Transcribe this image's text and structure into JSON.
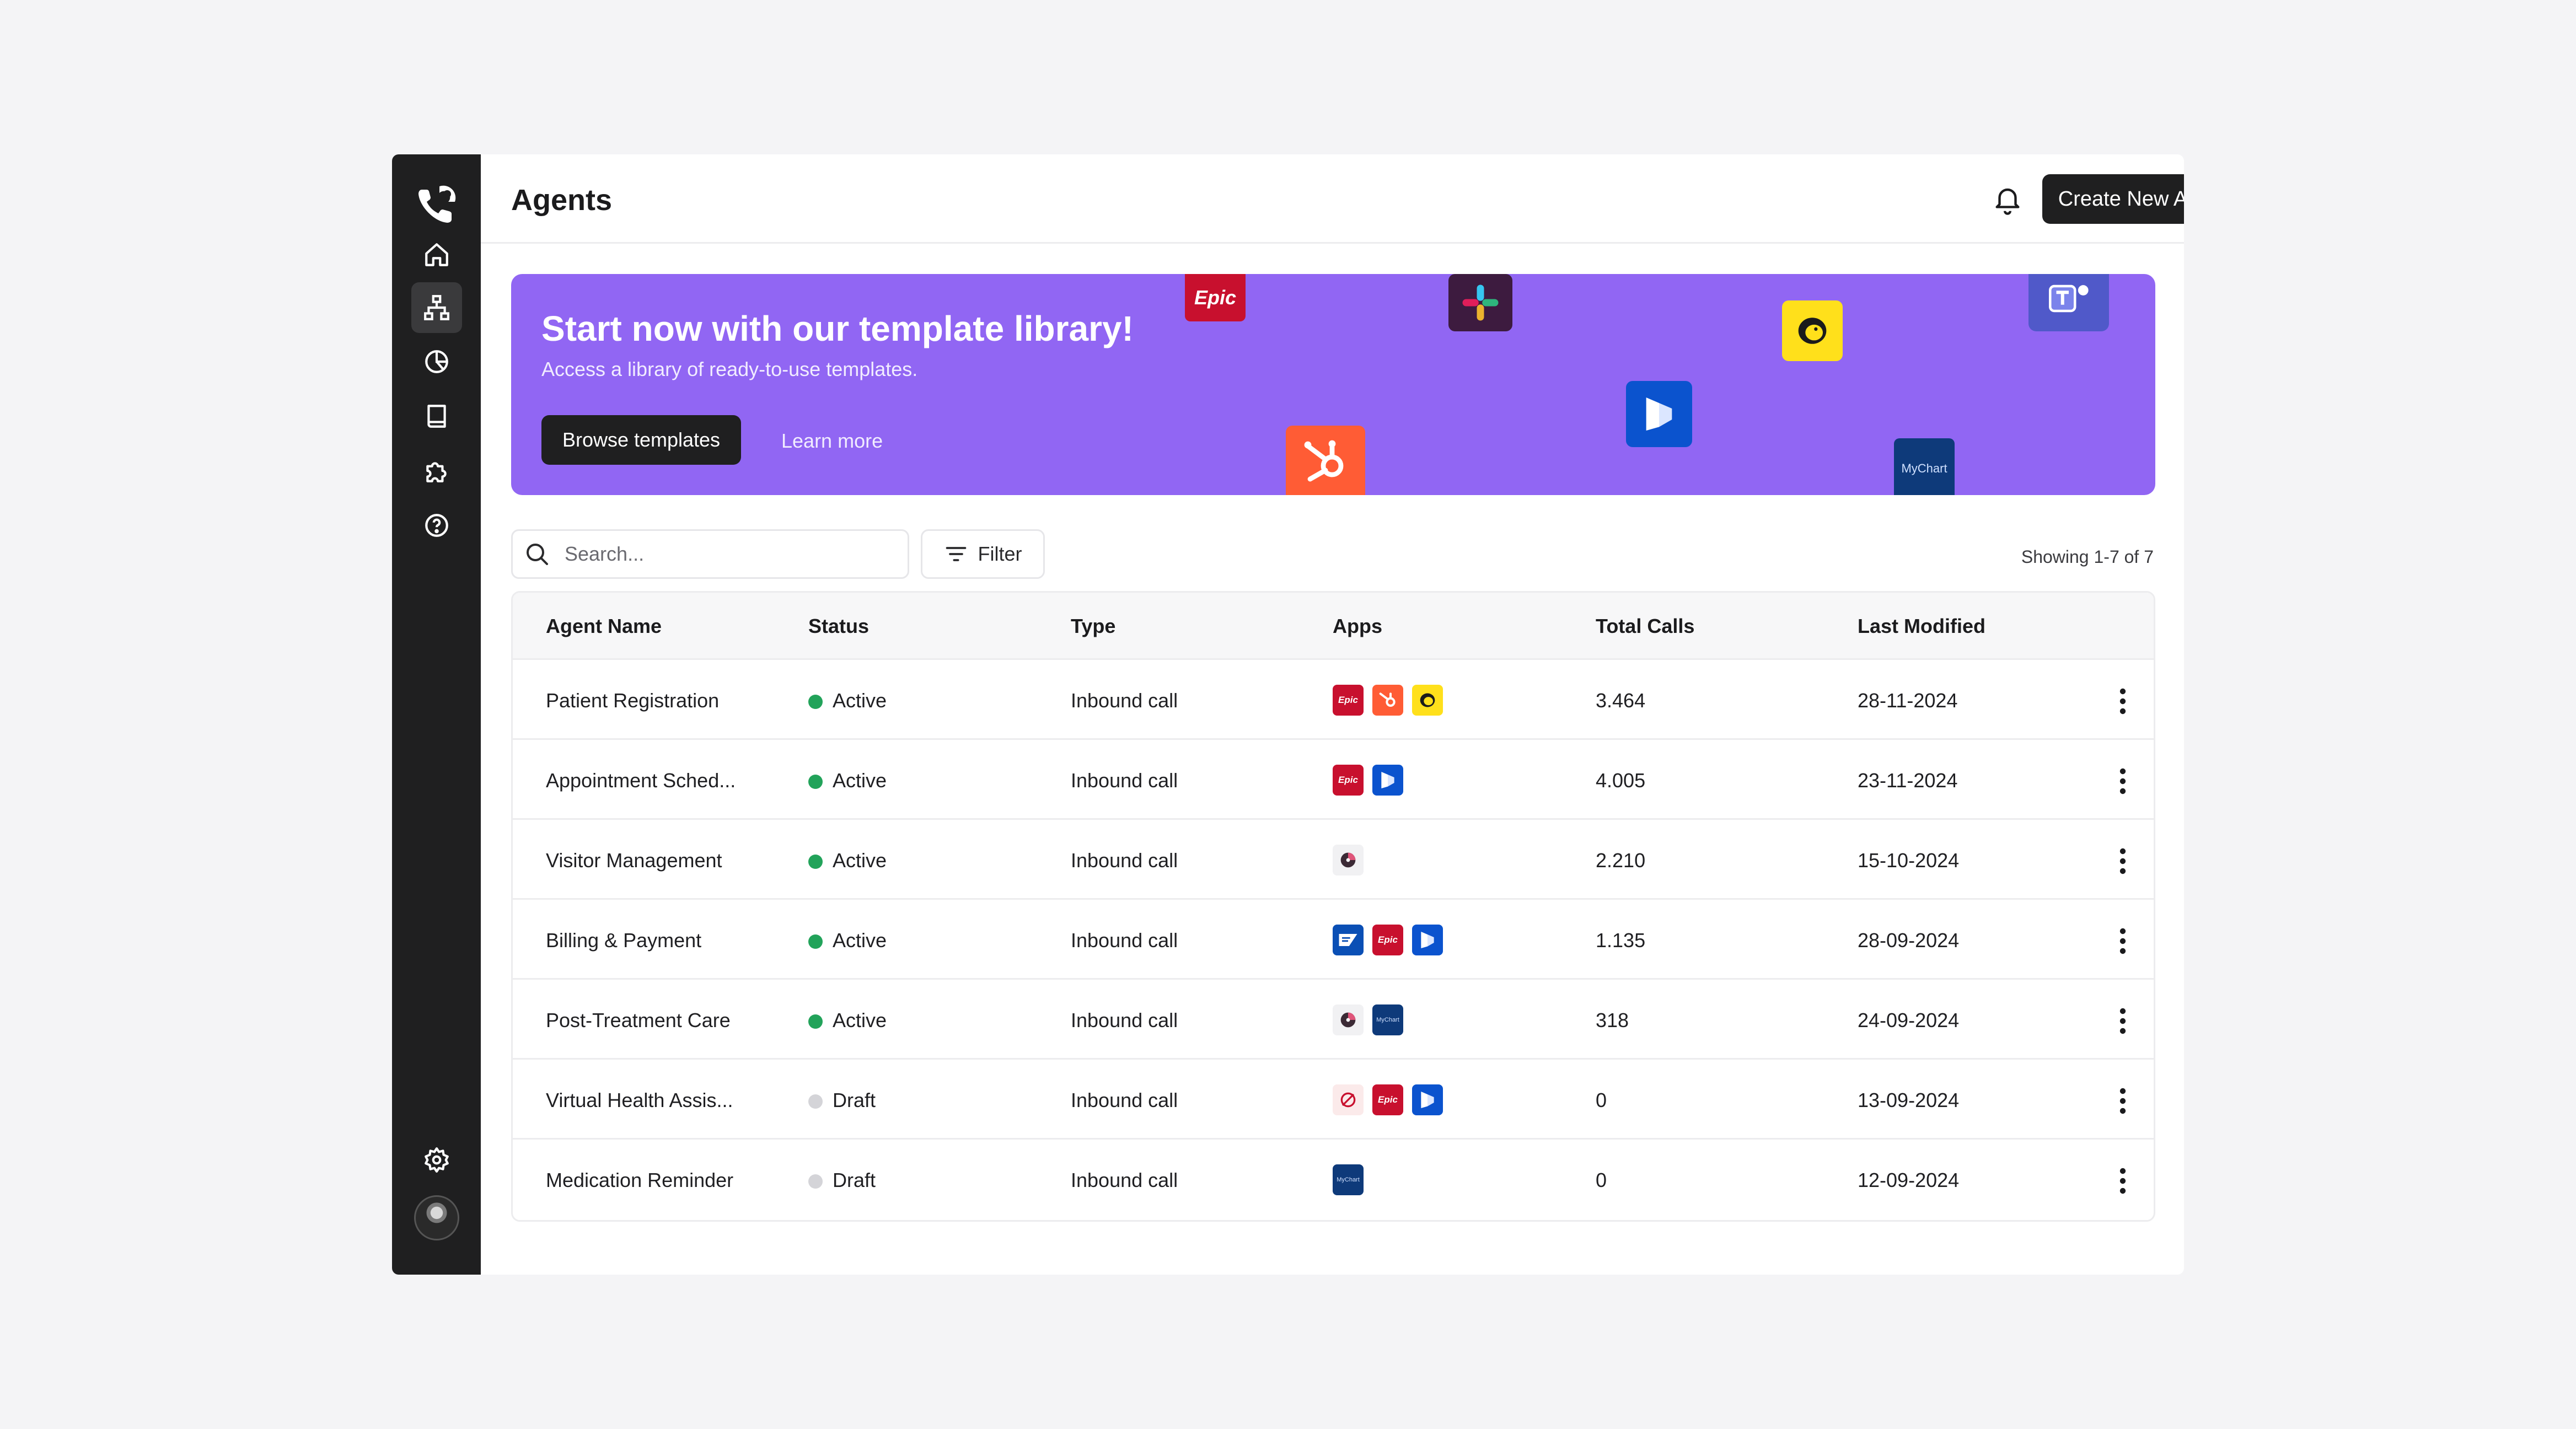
{
  "sidebar": {
    "nav": [
      "home",
      "agents",
      "analytics",
      "knowledge",
      "integrations",
      "help"
    ],
    "active": "agents"
  },
  "header": {
    "title": "Agents",
    "create_label": "Create New Agent"
  },
  "banner": {
    "title": "Start now with our template library!",
    "subtitle": "Access a library of ready-to-use templates.",
    "browse_label": "Browse templates",
    "learn_label": "Learn more",
    "color": "#9166f3",
    "logos": {
      "epic": "Epic",
      "mychart": "MyChart"
    }
  },
  "toolbar": {
    "search_placeholder": "Search...",
    "filter_label": "Filter",
    "showing": "Showing 1-7 of 7"
  },
  "table": {
    "headers": [
      "Agent Name",
      "Status",
      "Type",
      "Apps",
      "Total Calls",
      "Last Modified"
    ],
    "rows": [
      {
        "name": "Patient Registration",
        "status": "Active",
        "type": "Inbound call",
        "apps": [
          "epic",
          "hubspot",
          "mailchimp"
        ],
        "calls": "3.464",
        "modified": "28-11-2024"
      },
      {
        "name": "Appointment Sched...",
        "status": "Active",
        "type": "Inbound call",
        "apps": [
          "epic",
          "dynamics"
        ],
        "calls": "4.005",
        "modified": "23-11-2024"
      },
      {
        "name": "Visitor Management",
        "status": "Active",
        "type": "Inbound call",
        "apps": [
          "pinwheel"
        ],
        "calls": "2.210",
        "modified": "15-10-2024"
      },
      {
        "name": "Billing & Payment",
        "status": "Active",
        "type": "Inbound call",
        "apps": [
          "sap",
          "epic",
          "dynamics"
        ],
        "calls": "1.135",
        "modified": "28-09-2024"
      },
      {
        "name": "Post-Treatment Care",
        "status": "Active",
        "type": "Inbound call",
        "apps": [
          "pinwheel",
          "mychart"
        ],
        "calls": "318",
        "modified": "24-09-2024"
      },
      {
        "name": "Virtual Health Assis...",
        "status": "Draft",
        "type": "Inbound call",
        "apps": [
          "zendesk",
          "epic",
          "dynamics"
        ],
        "calls": "0",
        "modified": "13-09-2024"
      },
      {
        "name": "Medication Reminder",
        "status": "Draft",
        "type": "Inbound call",
        "apps": [
          "mychart"
        ],
        "calls": "0",
        "modified": "12-09-2024"
      }
    ]
  },
  "colors": {
    "active": "#22a35a",
    "draft": "#d4d4d8",
    "epic": "#c8102e",
    "hubspot": "#ff5c35",
    "mailchimp": "#ffe01b",
    "dynamics": "#0b53ce",
    "mychart": "#0e3a7a",
    "sap": "#0a4fb5"
  }
}
